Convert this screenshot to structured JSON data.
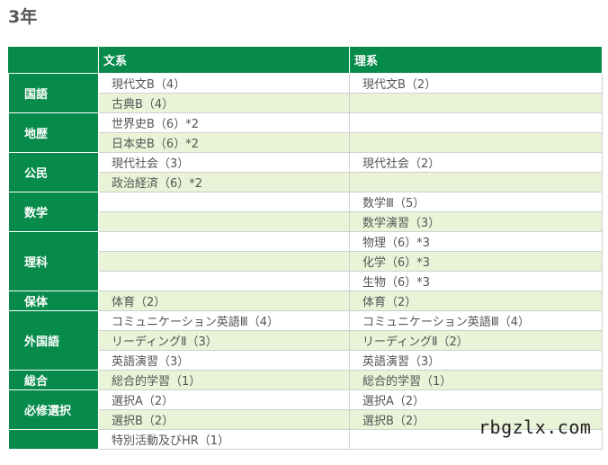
{
  "page_title": "3年",
  "headers": {
    "bunkei": "文系",
    "rikei": "理系"
  },
  "subjects": [
    {
      "name": "国語",
      "rows": [
        [
          "現代文B（4）",
          "現代文B（2）"
        ],
        [
          "古典B（4）",
          ""
        ]
      ]
    },
    {
      "name": "地歴",
      "rows": [
        [
          "世界史B（6）*2",
          ""
        ],
        [
          "日本史B（6）*2",
          ""
        ]
      ]
    },
    {
      "name": "公民",
      "rows": [
        [
          "現代社会（3）",
          "現代社会（2）"
        ],
        [
          "政治経済（6）*2",
          ""
        ]
      ]
    },
    {
      "name": "数学",
      "rows": [
        [
          "",
          "数学Ⅲ（5）"
        ],
        [
          "",
          "数学演習（3）"
        ]
      ]
    },
    {
      "name": "理科",
      "rows": [
        [
          "",
          "物理（6）*3"
        ],
        [
          "",
          "化学（6）*3"
        ],
        [
          "",
          "生物（6）*3"
        ]
      ]
    },
    {
      "name": "保体",
      "rows": [
        [
          "体育（2）",
          "体育（2）"
        ]
      ]
    },
    {
      "name": "外国語",
      "rows": [
        [
          "コミュニケーション英語Ⅲ（4）",
          "コミュニケーション英語Ⅲ（4）"
        ],
        [
          "リーディングⅡ（3）",
          "リーディングⅡ（2）"
        ],
        [
          "英語演習（3）",
          "英語演習（3）"
        ]
      ]
    },
    {
      "name": "総合",
      "rows": [
        [
          "総合的学習（1）",
          "総合的学習（1）"
        ]
      ]
    },
    {
      "name": "必修選択",
      "rows": [
        [
          "選択A（2）",
          "選択A（2）"
        ],
        [
          "選択B（2）",
          "選択B（2）"
        ]
      ]
    },
    {
      "name": "",
      "rows": [
        [
          "特別活動及びHR（1）",
          ""
        ]
      ]
    }
  ],
  "watermark": "rbgzlx.com"
}
